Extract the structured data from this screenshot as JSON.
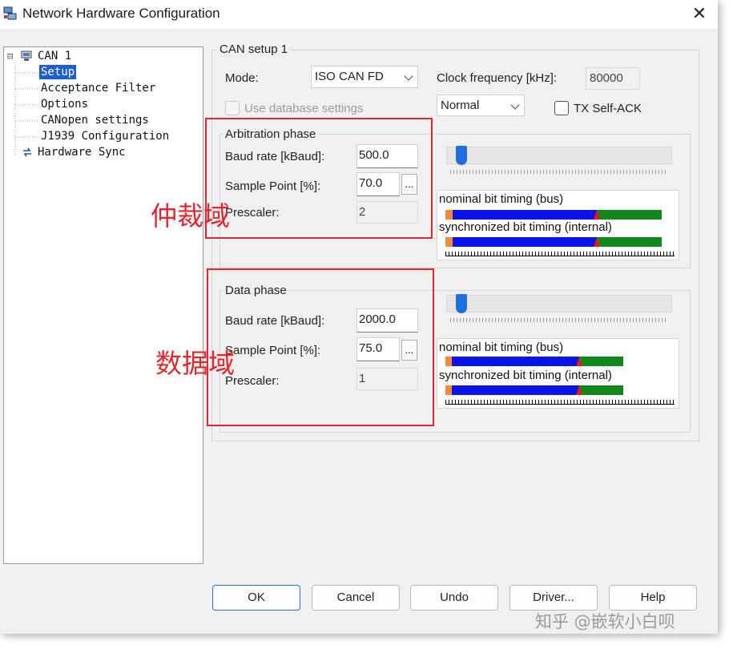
{
  "window": {
    "title": "Network Hardware Configuration",
    "close_glyph": "✕"
  },
  "tree": {
    "items": [
      {
        "label": "CAN 1",
        "expander": "⊟"
      },
      {
        "label": "Setup"
      },
      {
        "label": "Acceptance Filter"
      },
      {
        "label": "Options"
      },
      {
        "label": "CANopen settings"
      },
      {
        "label": "J1939 Configuration"
      },
      {
        "label": "Hardware Sync"
      }
    ]
  },
  "setup": {
    "group_title": "CAN setup 1",
    "mode_label": "Mode:",
    "mode_value": "ISO CAN FD",
    "clock_label": "Clock frequency [kHz]:",
    "clock_value": "80000",
    "normal_value": "Normal",
    "use_db_label": "Use database settings",
    "tx_self_ack_label": "TX Self-ACK"
  },
  "arbitration": {
    "title": "Arbitration phase",
    "baud_label": "Baud rate [kBaud]:",
    "baud_value": "500.0",
    "sample_label": "Sample Point [%]:",
    "sample_value": "70.0",
    "prescaler_label": "Prescaler:",
    "prescaler_value": "2",
    "dots": "...",
    "slider_fraction": 0.04,
    "nominal_label": "nominal bit timing (bus)",
    "sync_label": "synchronized bit timing (internal)",
    "sample_point_percent": 70
  },
  "data_phase": {
    "title": "Data phase",
    "baud_label": "Baud rate [kBaud]:",
    "baud_value": "2000.0",
    "sample_label": "Sample Point [%]:",
    "sample_value": "75.0",
    "prescaler_label": "Prescaler:",
    "prescaler_value": "1",
    "dots": "...",
    "slider_fraction": 0.04,
    "nominal_label": "nominal bit timing (bus)",
    "sync_label": "synchronized bit timing (internal)",
    "sample_point_percent": 75
  },
  "annotations": {
    "arbitration": "仲裁域",
    "data": "数据域"
  },
  "buttons": {
    "ok": "OK",
    "cancel": "Cancel",
    "undo": "Undo",
    "driver": "Driver...",
    "help": "Help"
  },
  "watermark": "知乎 @嵌软小白呗",
  "colors": {
    "sync_seg": "#f08a3c",
    "phase": "#0a14e6",
    "sample_marker": "#e8141e",
    "phase2": "#12871c",
    "annotation": "#e0262e",
    "accent": "#1d5fcf"
  }
}
